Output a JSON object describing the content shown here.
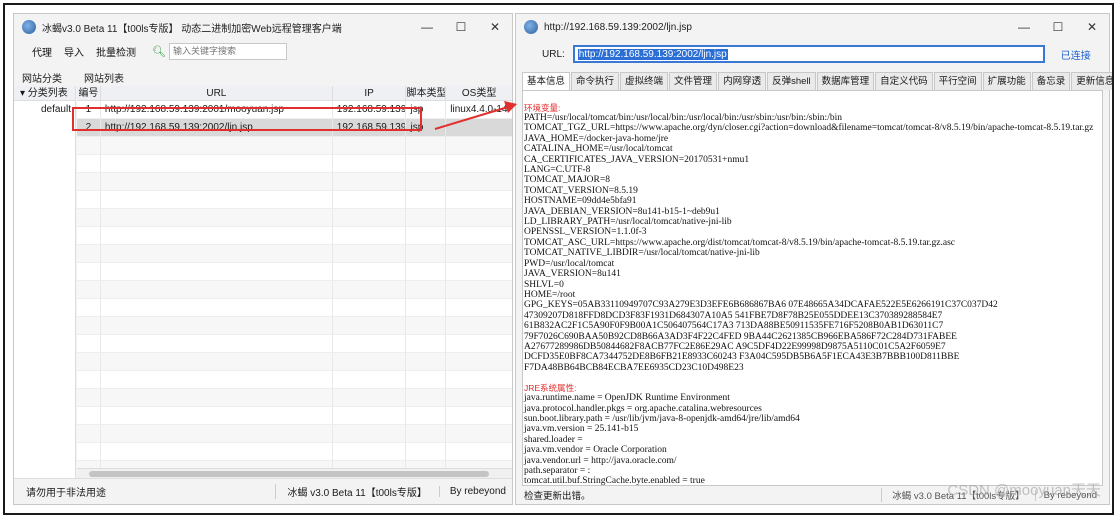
{
  "left_window": {
    "title": "冰蝎v3.0 Beta 11【t00ls专版】 动态二进制加密Web远程管理客户端",
    "toolbar": {
      "proxy": "代理",
      "import": "导入",
      "batch_check": "批量检测",
      "search_placeholder": "输入关键字搜索"
    },
    "panel_heads": {
      "category": "网站分类",
      "list": "网站列表"
    },
    "tree": {
      "header": "▾ 分类列表",
      "items": [
        "default"
      ]
    },
    "columns": [
      "编号",
      "URL",
      "IP",
      "脚本类型",
      "OS类型"
    ],
    "rows": [
      {
        "id": "1",
        "url": "http://192.168.59.139:2001/mooyuan.jsp",
        "ip": "192.168.59.139",
        "type": "jsp",
        "os": "linux4.4.0-14"
      },
      {
        "id": "2",
        "url": "http://192.168.59.139:2002/ljn.jsp",
        "ip": "192.168.59.139",
        "type": "jsp",
        "os": ""
      }
    ],
    "status": {
      "left": "请勿用于非法用途",
      "version": "冰蝎 v3.0 Beta 11【t00ls专版】",
      "author": "By rebeyond"
    }
  },
  "right_window": {
    "title": "http://192.168.59.139:2002/ljn.jsp",
    "url_label": "URL:",
    "url_value": "http://192.168.59.139:2002/ljn.jsp",
    "connected": "已连接",
    "tabs": [
      "基本信息",
      "命令执行",
      "虚拟终端",
      "文件管理",
      "内网穿透",
      "反弹shell",
      "数据库管理",
      "自定义代码",
      "平行空间",
      "扩展功能",
      "备忘录",
      "更新信息"
    ],
    "env_title": "环境变量:",
    "env_lines": [
      "PATH=/usr/local/tomcat/bin:/usr/local/bin:/usr/local/bin:/usr/sbin:/usr/bin:/sbin:/bin",
      "TOMCAT_TGZ_URL=https://www.apache.org/dyn/closer.cgi?action=download&filename=tomcat/tomcat-8/v8.5.19/bin/apache-tomcat-8.5.19.tar.gz",
      "JAVA_HOME=/docker-java-home/jre",
      "CATALINA_HOME=/usr/local/tomcat",
      "CA_CERTIFICATES_JAVA_VERSION=20170531+nmu1",
      "LANG=C.UTF-8",
      "TOMCAT_MAJOR=8",
      "TOMCAT_VERSION=8.5.19",
      "HOSTNAME=09dd4e5bfa91",
      "JAVA_DEBIAN_VERSION=8u141-b15-1~deb9u1",
      "LD_LIBRARY_PATH=/usr/local/tomcat/native-jni-lib",
      "OPENSSL_VERSION=1.1.0f-3",
      "TOMCAT_ASC_URL=https://www.apache.org/dist/tomcat/tomcat-8/v8.5.19/bin/apache-tomcat-8.5.19.tar.gz.asc",
      "TOMCAT_NATIVE_LIBDIR=/usr/local/tomcat/native-jni-lib",
      "PWD=/usr/local/tomcat",
      "JAVA_VERSION=8u141",
      "SHLVL=0",
      "HOME=/root",
      "GPG_KEYS=05AB33110949707C93A279E3D3EFE6B686867BA6 07E48665A34DCAFAE522E5E6266191C37C037D42",
      "47309207D818FFD8DCD3F83F1931D684307A10A5 541FBE7D8F78B25E055DDEE13C370389288584E7",
      "61B832AC2F1C5A90F0F9B00A1C506407564C17A3 713DA88BE50911535FE716F5208B0AB1D63011C7",
      "79F7026C690BAA50B92CD8B66A3AD3F4F22C4FED 9BA44C2621385CB966EBA586F72C284D731FABEE",
      "A27677289986DB50844682F8ACB77FC2E86E29AC A9C5DF4D22E99998D9875A5110C01C5A2F6059E7",
      "DCFD35E0BF8CA7344752DE8B6FB21E8933C60243 F3A04C595DB5B6A5F1ECA43E3B7BBB100D811BBE",
      "F7DA48BB64BCB84ECBA7EE6935CD23C10D498E23"
    ],
    "jre_title": "JRE系统属性:",
    "jre_lines": [
      "java.runtime.name = OpenJDK Runtime Environment",
      "java.protocol.handler.pkgs = org.apache.catalina.webresources",
      "sun.boot.library.path = /usr/lib/jvm/java-8-openjdk-amd64/jre/lib/amd64",
      "java.vm.version = 25.141-b15",
      "shared.loader =",
      "java.vm.vendor = Oracle Corporation",
      "java.vendor.url = http://java.oracle.com/",
      "path.separator = :",
      "tomcat.util.buf.StringCache.byte.enabled = true"
    ],
    "status": {
      "left": "检查更新出错。",
      "version": "冰蝎 v3.0 Beta 11【t00ls专版】",
      "author": "By rebeyond"
    },
    "watermark": "CSDN @mooyuan天天"
  },
  "colors": {
    "highlight_red": "#e0302e",
    "link_blue": "#1f5fd0",
    "section_red": "#e22a2a"
  }
}
